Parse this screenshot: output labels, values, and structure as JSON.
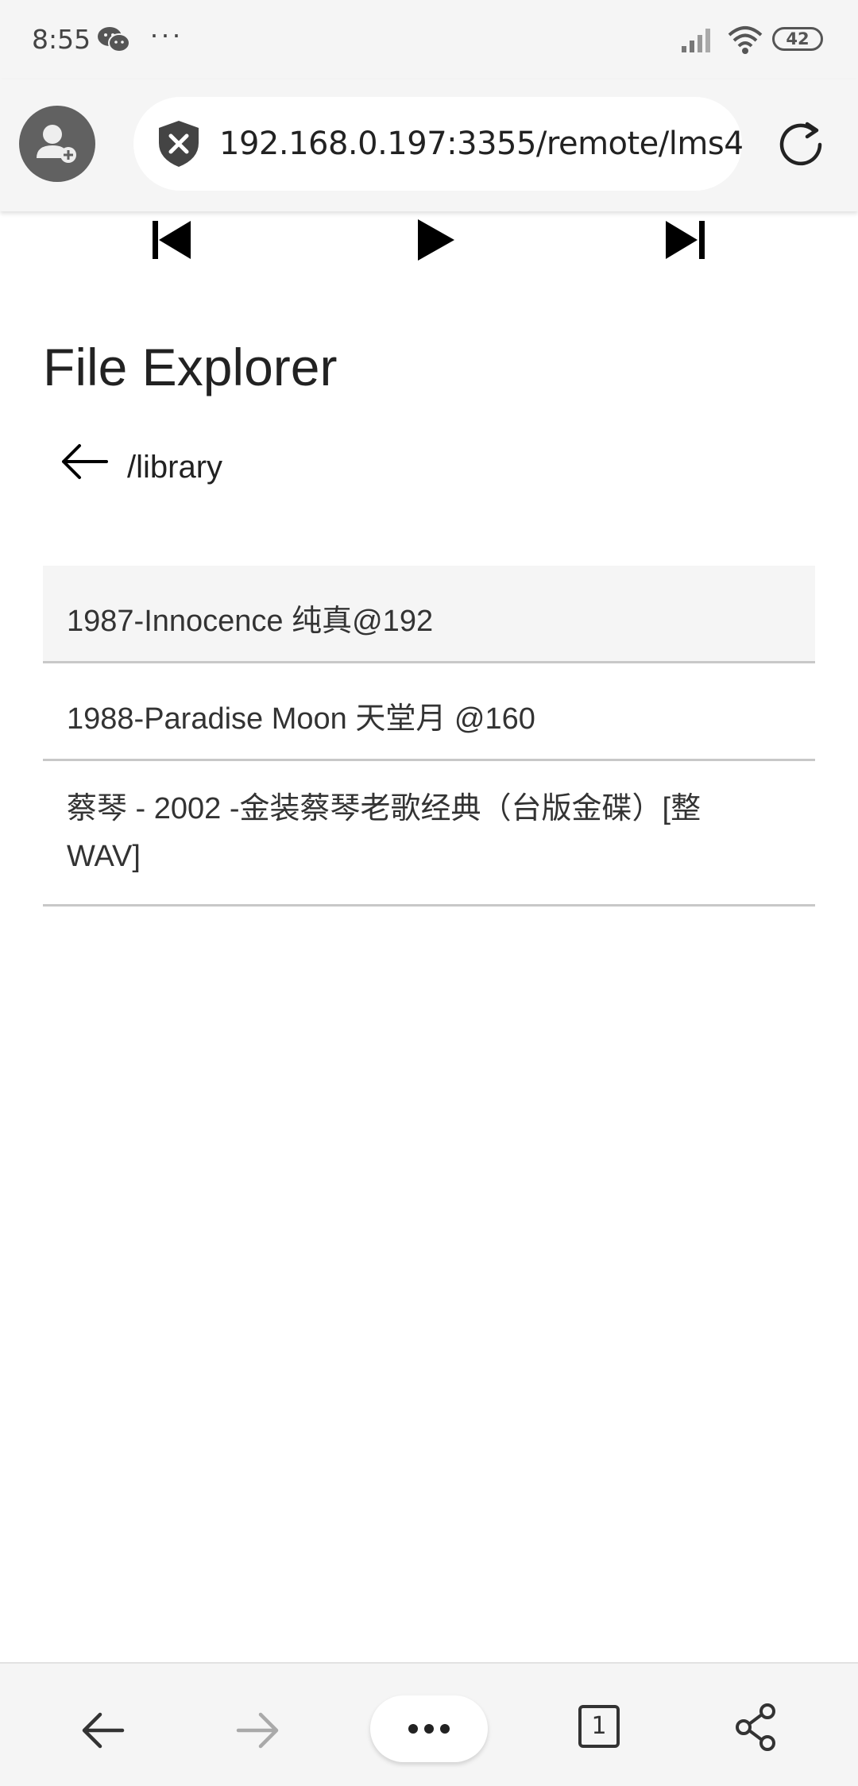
{
  "status_bar": {
    "time": "8:55",
    "more": "···",
    "battery": "42",
    "icons": [
      "wechat-icon",
      "signal-icon",
      "wifi-icon",
      "battery-icon"
    ]
  },
  "browser": {
    "url": "192.168.0.197:3355/remote/lms4",
    "icons": [
      "profile-avatar-icon",
      "insecure-shield-icon",
      "reload-icon"
    ]
  },
  "media": {
    "icons": [
      "skip-previous-icon",
      "play-icon",
      "skip-next-icon"
    ]
  },
  "explorer": {
    "title": "File Explorer",
    "path": "/library",
    "items": [
      {
        "label": "1987-Innocence 纯真@192",
        "selected": true
      },
      {
        "label": "1988-Paradise Moon 天堂月 @160",
        "selected": false
      },
      {
        "label_line1": "蔡琴 - 2002 -金装蔡琴老歌经典（台版金碟）[整",
        "label_line2": "WAV]",
        "selected": false
      }
    ]
  },
  "bottom_nav": {
    "tab_count": "1",
    "icons": [
      "back-arrow-icon",
      "forward-arrow-icon",
      "more-menu-icon",
      "tabs-icon",
      "share-icon"
    ]
  },
  "colors": {
    "chrome_background": "#f5f5f5",
    "selected_row": "#f5f5f5",
    "divider": "#c8c8c8",
    "text": "#222222",
    "disabled": "#a9a9a9"
  }
}
